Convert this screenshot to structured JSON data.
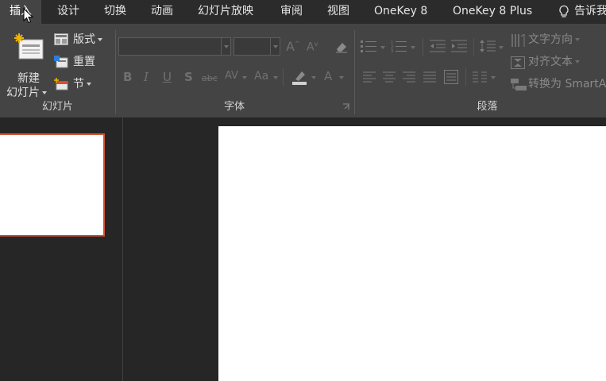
{
  "tabs": {
    "insert": "插入",
    "design": "设计",
    "transitions": "切换",
    "animations": "动画",
    "slideshow": "幻灯片放映",
    "review": "审阅",
    "view": "视图",
    "onekey8": "OneKey 8",
    "onekey8plus": "OneKey 8 Plus",
    "tell_me": "告诉我"
  },
  "ribbon": {
    "slides": {
      "new_slide_line1": "新建",
      "new_slide_line2": "幻灯片",
      "layout": "版式",
      "reset": "重置",
      "section": "节",
      "group_label": "幻灯片"
    },
    "font": {
      "group_label": "字体",
      "bold": "B",
      "italic": "I",
      "underline": "U",
      "shadow": "S",
      "strikethrough": "abc",
      "spacing": "AV",
      "change_case": "Aa",
      "font_color": "A",
      "grow": "A",
      "shrink": "A"
    },
    "paragraph": {
      "group_label": "段落",
      "text_direction": "文字方向",
      "align_text": "对齐文本",
      "convert_smartart": "转换为 SmartArt"
    }
  },
  "colors": {
    "tabbar": "#2b2b2b",
    "ribbon": "#444444",
    "workspace": "#262626",
    "thumb_border": "#d35230",
    "slide": "#ffffff"
  },
  "icons": {
    "tell_me": "lightbulb-icon",
    "new_slide": "new-slide-icon",
    "layout": "layout-icon",
    "reset": "reset-icon",
    "section": "section-icon"
  }
}
